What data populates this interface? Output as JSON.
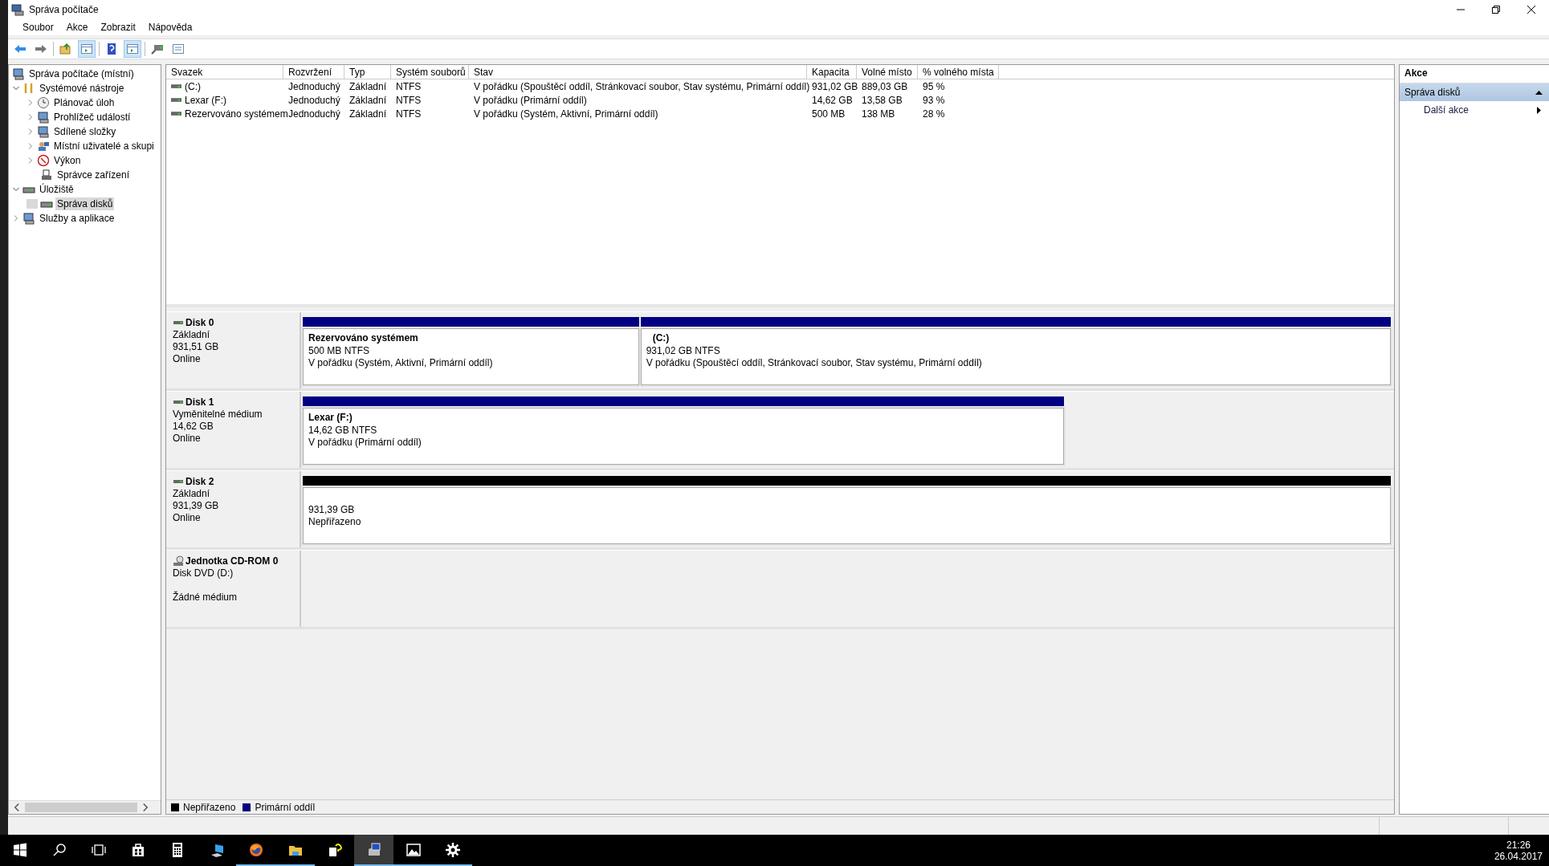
{
  "window": {
    "title": "Správa počítače"
  },
  "menu": [
    "Soubor",
    "Akce",
    "Zobrazit",
    "Nápověda"
  ],
  "toolbar": [
    {
      "selected": false
    },
    {
      "selected": false
    },
    {
      "selected": false
    },
    {
      "selected": true
    },
    {
      "selected": false
    },
    {
      "selected": true
    },
    {
      "selected": false
    },
    {
      "selected": false
    }
  ],
  "tree": [
    {
      "label": "Správa počítače (místní)",
      "selected": false,
      "children": [
        {
          "label": "Systémové nástroje",
          "selected": false,
          "expanded": true,
          "children": [
            {
              "label": "Plánovač úloh",
              "selected": false,
              "expanded": false
            },
            {
              "label": "Prohlížeč událostí",
              "selected": false,
              "expanded": false
            },
            {
              "label": "Sdílené složky",
              "selected": false,
              "expanded": false
            },
            {
              "label": "Místní uživatelé a skupi",
              "selected": false,
              "expanded": false
            },
            {
              "label": "Výkon",
              "selected": false,
              "expanded": false
            },
            {
              "label": "Správce zařízení",
              "selected": false
            }
          ]
        },
        {
          "label": "Úložiště",
          "selected": false,
          "expanded": true,
          "children": [
            {
              "label": "Správa disků",
              "selected": true
            }
          ]
        },
        {
          "label": "Služby a aplikace",
          "selected": false,
          "expanded": false
        }
      ]
    }
  ],
  "table": {
    "columns": [
      "Svazek",
      "Rozvržení",
      "Typ",
      "Systém souborů",
      "Stav",
      "Kapacita",
      "Volné místo",
      "% volného místa"
    ],
    "rows": [
      [
        "(C:)",
        "Jednoduchý",
        "Základní",
        "NTFS",
        "V pořádku (Spouštěcí oddíl, Stránkovací soubor, Stav systému, Primární oddíl)",
        "931,02 GB",
        "889,03 GB",
        "95 %"
      ],
      [
        "Lexar (F:)",
        "Jednoduchý",
        "Základní",
        "NTFS",
        "V pořádku (Primární oddíl)",
        "14,62 GB",
        "13,58 GB",
        "93 %"
      ],
      [
        "Rezervováno systémem",
        "Jednoduchý",
        "Základní",
        "NTFS",
        "V pořádku (Systém, Aktivní, Primární oddíl)",
        "500 MB",
        "138 MB",
        "28 %"
      ]
    ]
  },
  "disks": [
    {
      "kind": "disk",
      "name": "Disk 0",
      "lines": [
        "Základní",
        "931,51 GB",
        "Online"
      ],
      "partitions": [
        {
          "kind": "primary",
          "title": "Rezervováno systémem",
          "lines": [
            "500 MB NTFS",
            "V pořádku (Systém, Aktivní, Primární oddíl)"
          ]
        },
        {
          "kind": "primary",
          "title": "(C:)",
          "lines": [
            "931,02 GB NTFS",
            "V pořádku (Spouštěcí oddíl, Stránkovací soubor, Stav systému, Primární oddíl)"
          ]
        }
      ]
    },
    {
      "kind": "disk",
      "name": "Disk 1",
      "lines": [
        "Vyměnitelné médium",
        "14,62 GB",
        "Online"
      ],
      "partitions": [
        {
          "kind": "primary",
          "title": "Lexar (F:)",
          "lines": [
            "14,62 GB NTFS",
            "V pořádku (Primární oddíl)"
          ]
        }
      ]
    },
    {
      "kind": "disk",
      "name": "Disk 2",
      "lines": [
        "Základní",
        "931,39 GB",
        "Online"
      ],
      "partitions": [
        {
          "kind": "unallocated",
          "lines": [
            "931,39 GB",
            "Nepřiřazeno"
          ]
        }
      ]
    },
    {
      "kind": "cdrom",
      "name": "Jednotka CD-ROM 0",
      "lines": [
        "Disk DVD (D:)",
        "Žádné médium"
      ]
    }
  ],
  "legend": [
    {
      "label": "Nepřiřazeno",
      "color": "#000000"
    },
    {
      "label": "Primární oddíl",
      "color": "#000080"
    }
  ],
  "actions": {
    "title": "Akce",
    "section": {
      "label": "Správa disků",
      "expanded": true
    },
    "items": [
      "Další akce"
    ]
  },
  "taskbar": {
    "apps": [
      {
        "running": false,
        "selected": false
      },
      {
        "running": false,
        "selected": false
      },
      {
        "running": false,
        "selected": false
      },
      {
        "running": false,
        "selected": false
      },
      {
        "running": false,
        "selected": false
      },
      {
        "running": false,
        "selected": false
      },
      {
        "running": true,
        "selected": false
      },
      {
        "running": true,
        "selected": false
      },
      {
        "running": false,
        "selected": false
      },
      {
        "running": true,
        "selected": true
      },
      {
        "running": true,
        "selected": false
      },
      {
        "running": true,
        "selected": false
      }
    ],
    "time": "21:26",
    "date": "26.04.2017"
  }
}
